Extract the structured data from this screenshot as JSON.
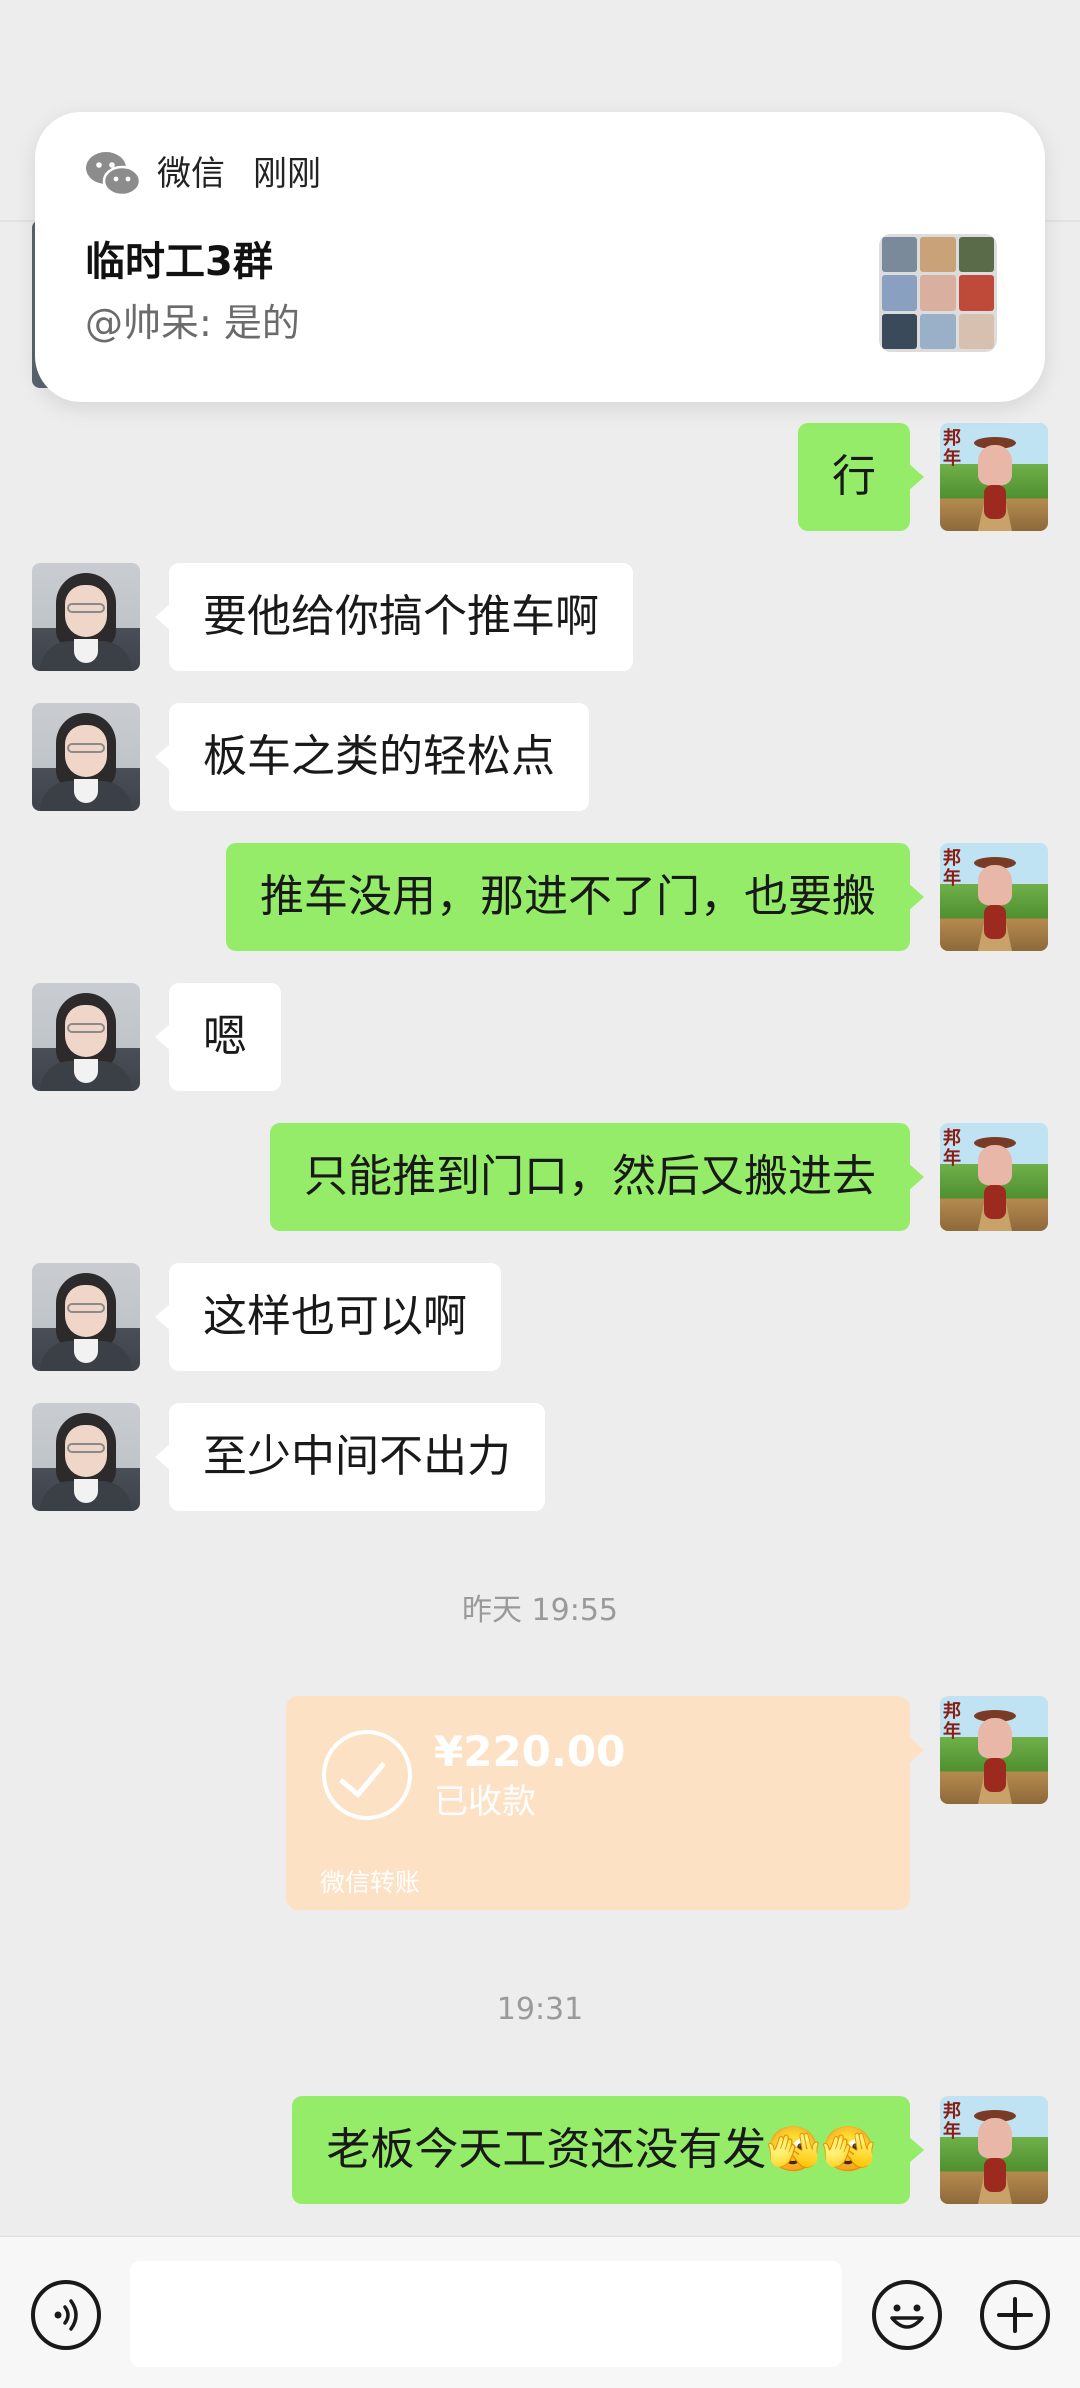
{
  "notification": {
    "app_name": "微信",
    "time": "刚刚",
    "title": "临时工3群",
    "body": "@帅呆: 是的",
    "icon": "wechat-icon"
  },
  "messages": [
    {
      "side": "right",
      "text": "行"
    },
    {
      "side": "left",
      "text": "要他给你搞个推车啊"
    },
    {
      "side": "left",
      "text": "板车之类的轻松点"
    },
    {
      "side": "right",
      "text": "推车没用，那进不了门，也要搬"
    },
    {
      "side": "left",
      "text": "嗯"
    },
    {
      "side": "right",
      "text": "只能推到门口，然后又搬进去"
    },
    {
      "side": "left",
      "text": "这样也可以啊"
    },
    {
      "side": "left",
      "text": "至少中间不出力"
    },
    {
      "side": "right",
      "text": "老板今天工资还没有发🫣🫣"
    }
  ],
  "time_separators": {
    "first": "昨天 19:55",
    "second": "19:31"
  },
  "transfer": {
    "amount": "¥220.00",
    "status": "已收款",
    "footer": "微信转账",
    "icon": "check-circle-icon",
    "color": "#fde1c4"
  },
  "avatar_badge_text": "邦年",
  "input_bar": {
    "voice_icon": "voice-icon",
    "emoji_icon": "emoji-icon",
    "plus_icon": "plus-icon",
    "placeholder": ""
  },
  "colors": {
    "background": "#ededed",
    "sent_bubble": "#95ec69",
    "received_bubble": "#ffffff"
  }
}
